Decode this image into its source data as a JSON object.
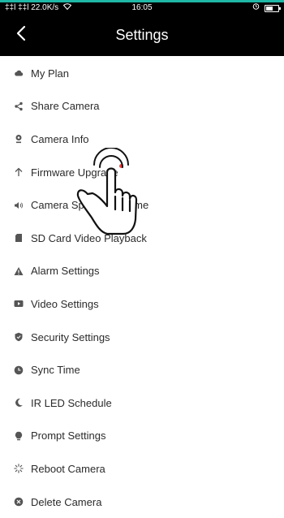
{
  "status_bar": {
    "signal_text": "‡‡l ‡‡l",
    "network_speed": "22.0K/s",
    "time": "16:05"
  },
  "header": {
    "title": "Settings"
  },
  "colors": {
    "accent": "#1fb8a6",
    "header_bg": "#000000",
    "icon": "#555555",
    "notification_dot": "#f04040"
  },
  "settings": {
    "items": [
      {
        "label": "My Plan",
        "icon": "cloud-icon"
      },
      {
        "label": "Share Camera",
        "icon": "share-icon"
      },
      {
        "label": "Camera Info",
        "icon": "camera-info-icon"
      },
      {
        "label": "Firmware Upgrade",
        "icon": "arrow-up-icon",
        "has_update_dot": true
      },
      {
        "label": "Camera Speaker Volume",
        "icon": "speaker-icon"
      },
      {
        "label": "SD Card Video Playback",
        "icon": "sd-card-icon"
      },
      {
        "label": "Alarm Settings",
        "icon": "warning-icon"
      },
      {
        "label": "Video Settings",
        "icon": "video-icon"
      },
      {
        "label": "Security Settings",
        "icon": "shield-icon"
      },
      {
        "label": "Sync Time",
        "icon": "clock-icon"
      },
      {
        "label": "IR LED Schedule",
        "icon": "moon-icon"
      },
      {
        "label": "Prompt Settings",
        "icon": "bulb-icon"
      },
      {
        "label": "Reboot Camera",
        "icon": "reboot-icon"
      },
      {
        "label": "Delete Camera",
        "icon": "delete-icon"
      }
    ]
  }
}
